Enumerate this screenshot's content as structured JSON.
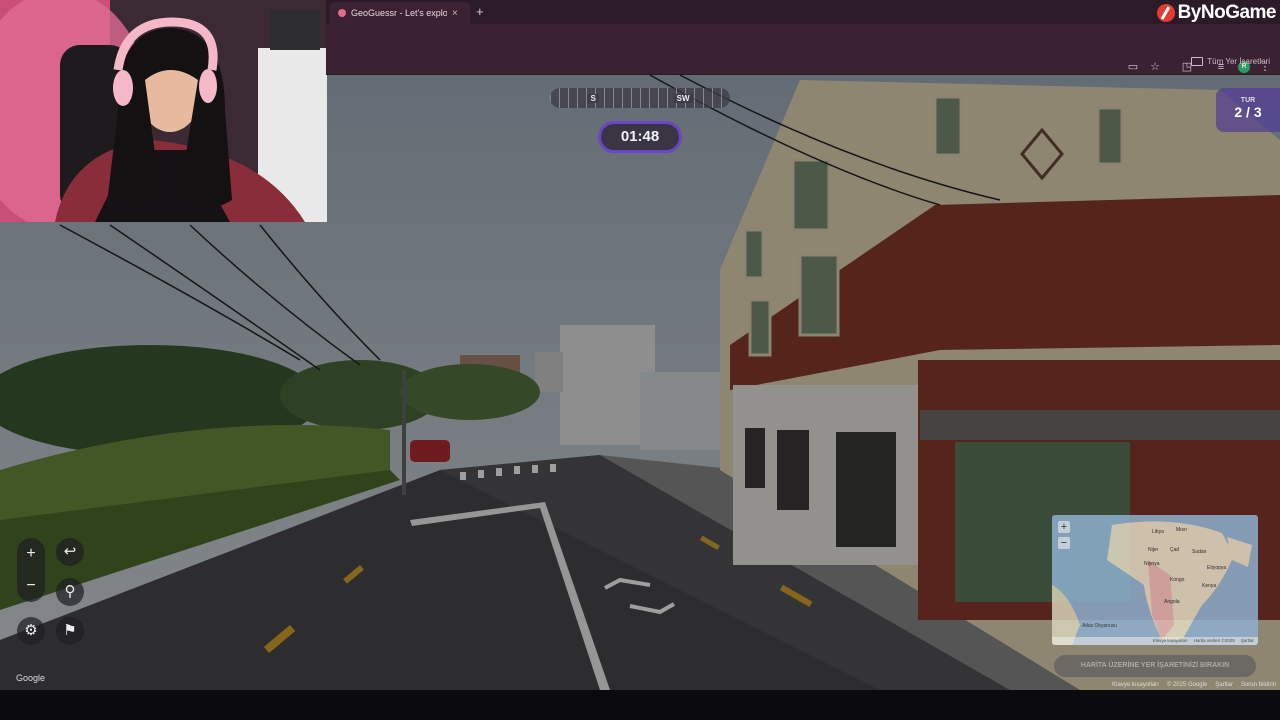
{
  "browser": {
    "tab_title": "GeoGuessr - Let's explore the w",
    "tab_close": "×",
    "new_tab": "+",
    "bookmarks_label": "Tüm Yer İşaretleri",
    "profile_initial": "R"
  },
  "stream": {
    "brand": "ByNoGame"
  },
  "game": {
    "compass": {
      "left_heading": "S",
      "right_heading": "SW"
    },
    "timer": "01:48",
    "round_label": "TUR",
    "round_value": "2 / 3",
    "guess_button": "HARİTA ÜZERİNE YER İŞARETİNİZİ BIRAKIN",
    "controls": {
      "zoom_in": "+",
      "zoom_out": "−",
      "undo": "↩",
      "pin": "⚲",
      "settings": "⚙",
      "flag": "⚑"
    },
    "google_watermark": "Google"
  },
  "minimap": {
    "zoom_in": "+",
    "zoom_out": "−",
    "labels": [
      "Mısır",
      "Libya",
      "Nijer",
      "Çad",
      "Sudan",
      "Nijerya",
      "Kongo",
      "Etiyopya",
      "Kenya",
      "Angola",
      "Atlas Okyanusu"
    ],
    "attribution": [
      "Klavye kısayolları",
      "Harita verileri ©2025",
      "Şartlar"
    ]
  },
  "streetview_footer": [
    "Klavye kısayolları",
    "© 2025 Google",
    "Şartlar",
    "Sorun bildirin"
  ],
  "colors": {
    "timer_border": "#6a46c8",
    "round_bg": "#503c96",
    "browser_bg": "#3a2233",
    "brand_icon": "#e33b2f"
  }
}
